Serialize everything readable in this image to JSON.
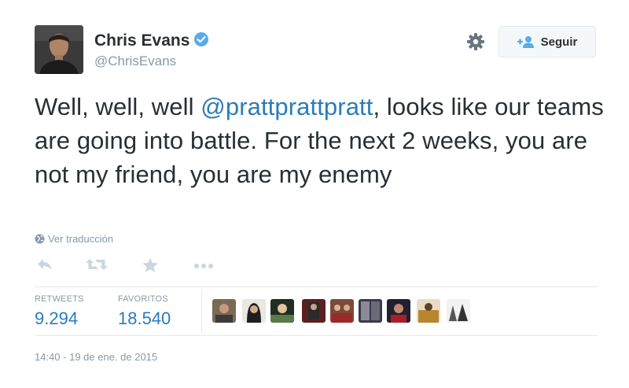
{
  "author": {
    "name": "Chris Evans",
    "handle": "@ChrisEvans",
    "verified": true
  },
  "header": {
    "follow_label": "Seguir"
  },
  "tweet": {
    "text_before": "Well, well, well ",
    "mention": "@prattprattpratt",
    "text_after": ", looks like our teams are going into battle. For the next 2 weeks, you are not my friend, you are my enemy",
    "translate_label": "Ver traducción"
  },
  "stats": {
    "retweets_label": "RETWEETS",
    "retweets_value": "9.294",
    "favorites_label": "FAVORITOS",
    "favorites_value": "18.540"
  },
  "timestamp": "14:40 - 19 de ene. de 2015",
  "icons": {
    "reply": "reply-icon",
    "retweet": "retweet-icon",
    "favorite": "star-icon",
    "more": "more-icon",
    "settings": "gear-icon",
    "follow": "follow-icon",
    "verified": "verified-badge-icon",
    "translate": "globe-icon"
  },
  "colors": {
    "link": "#2b7bb9",
    "muted": "#8899a6",
    "text": "#292f33",
    "verified": "#55acee",
    "divider": "#e1e8ed"
  }
}
